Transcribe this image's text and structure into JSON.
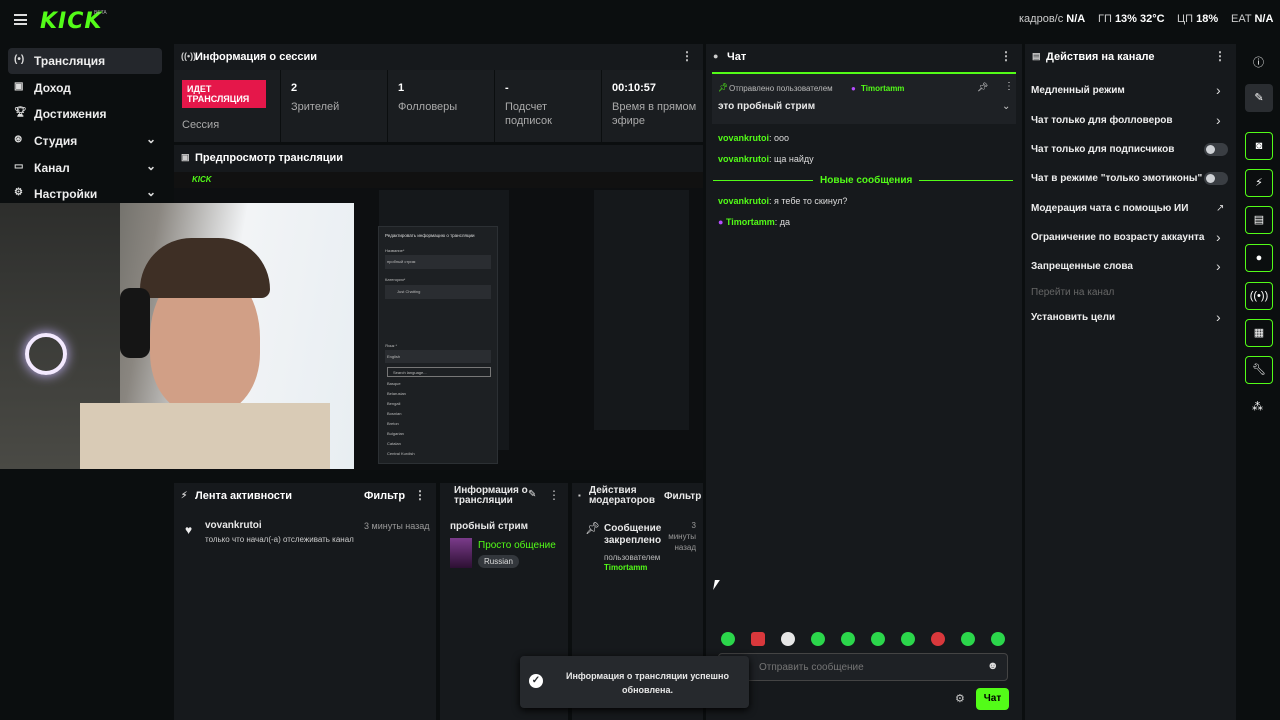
{
  "topbar": {
    "logo": "KICK",
    "beta": "BETA",
    "fps_label": "кадров/с",
    "fps_value": "N/A",
    "gpu_label": "ГП",
    "gpu_value": "13%",
    "gpu_temp": "32°C",
    "cpu_label": "ЦП",
    "cpu_value": "18%",
    "eat_label": "EAT",
    "eat_value": "N/A"
  },
  "sidebar": {
    "items": [
      {
        "label": "Трансляция",
        "icon": "broadcast-icon"
      },
      {
        "label": "Доход",
        "icon": "wallet-icon"
      },
      {
        "label": "Достижения",
        "icon": "trophy-icon"
      },
      {
        "label": "Студия",
        "icon": "studio-icon"
      },
      {
        "label": "Канал",
        "icon": "channel-icon"
      },
      {
        "label": "Настройки",
        "icon": "gear-icon"
      }
    ]
  },
  "session": {
    "title": "Информация о сессии",
    "live_badge": "ИДЕТ ТРАНСЛЯЦИЯ",
    "live_sub": "Сессия",
    "viewers_value": "2",
    "viewers_label": "Зрителей",
    "followers_value": "1",
    "followers_label": "Фолловеры",
    "subs_value": "-",
    "subs_label": "Подсчет подписок",
    "time_value": "00:10:57",
    "time_label": "Время в прямом эфире"
  },
  "preview": {
    "title": "Предпросмотр трансляции",
    "modal_title": "Редактировать информацию о трансляции",
    "modal_name_label": "Название*",
    "modal_name_value": "пробный стрим",
    "modal_category_label": "Категория*",
    "modal_category_value": "Just Chatting",
    "modal_lang_label": "Язык *",
    "modal_lang_value": "English",
    "modal_search": "Search language...",
    "modal_langs": [
      "Basque",
      "Belarusian",
      "Bengali",
      "Bosnian",
      "Breton",
      "Bulgarian",
      "Catalan",
      "Central Kurdish"
    ]
  },
  "activity": {
    "title": "Лента активности",
    "filter": "Фильтр",
    "user": "vovankrutoi",
    "time": "3 минуты назад",
    "text": "только что начал(-а) отслеживать канал"
  },
  "stream_info": {
    "title": "Информация о трансляции",
    "stream_title": "пробный стрим",
    "category": "Просто общение",
    "language": "Russian"
  },
  "mod_actions": {
    "title": "Действия модераторов",
    "filter": "Фильтр",
    "action": "Сообщение закреплено",
    "time": "3 минуты назад",
    "by": "пользователем",
    "user": "Timortamm"
  },
  "chat": {
    "title": "Чат",
    "pinned_by": "Отправлено пользователем",
    "pinned_user": "Timortamm",
    "pinned_text": "это пробный стрим",
    "new_messages": "Новые сообщения",
    "messages": [
      {
        "user": "vovankrutoi",
        "text": ": ооо"
      },
      {
        "user": "vovankrutoi",
        "text": ": ща найду"
      },
      {
        "user": "vovankrutoi",
        "text": ": я тебе то скинул?"
      },
      {
        "user": "Timortamm",
        "text": ": да"
      }
    ],
    "input_placeholder": "Отправить сообщение",
    "send_label": "Чат"
  },
  "channel_actions": {
    "title": "Действия на канале",
    "items": [
      {
        "label": "Медленный режим"
      },
      {
        "label": "Чат только для фолловеров"
      },
      {
        "label": "Чат только для подписчиков"
      },
      {
        "label": "Чат в режиме \"только эмотиконы\""
      },
      {
        "label": "Модерация чата с помощью ИИ"
      },
      {
        "label": "Ограничение по возрасту аккаунта"
      },
      {
        "label": "Запрещенные слова"
      },
      {
        "label": "Перейти на канал"
      },
      {
        "label": "Установить цели"
      }
    ]
  },
  "toast": {
    "text": "Информация о трансляции успешно обновлена."
  },
  "colors": {
    "brand": "#53fc18",
    "live": "#e5174a",
    "panel": "#16191c"
  }
}
